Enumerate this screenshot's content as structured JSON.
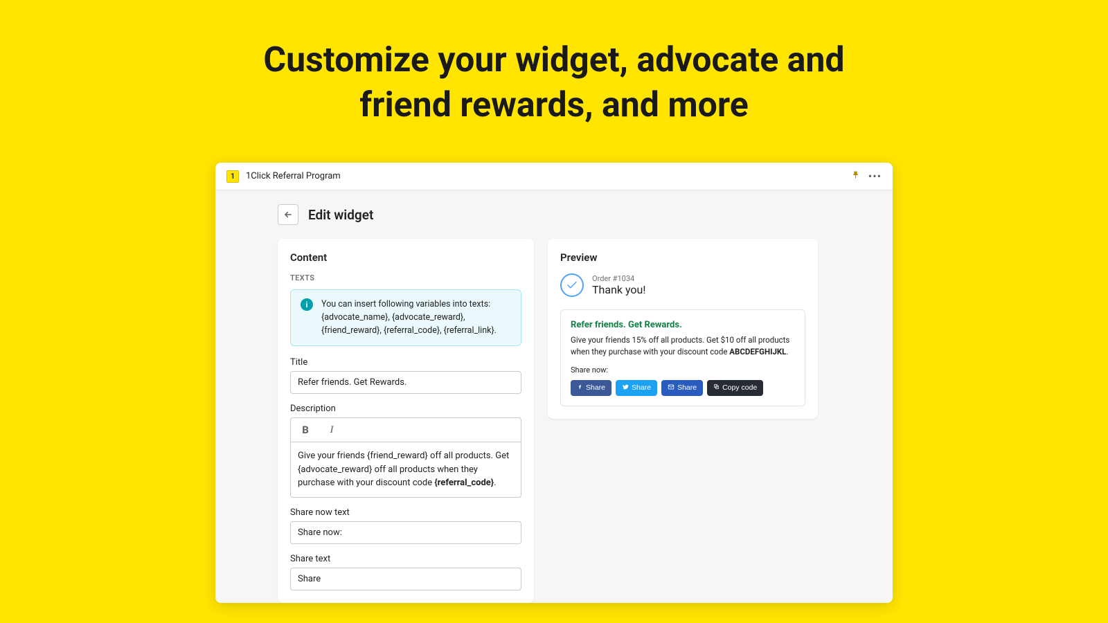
{
  "hero": {
    "headline": "Customize your widget, advocate and friend rewards, and more"
  },
  "app": {
    "badge": "1",
    "title": "1Click Referral Program"
  },
  "page": {
    "title": "Edit widget"
  },
  "content": {
    "heading": "Content",
    "texts_label": "TEXTS",
    "info": "You can insert following variables into texts: {advocate_name}, {advocate_reward}, {friend_reward}, {referral_code}, {referral_link}.",
    "fields": {
      "title_label": "Title",
      "title_value": "Refer friends. Get Rewards.",
      "description_label": "Description",
      "description_plain": "Give your friends {friend_reward} off all products. Get {advocate_reward} off all products when they purchase with your discount code ",
      "description_code": "{referral_code}",
      "description_suffix": ".",
      "share_now_label": "Share now text",
      "share_now_value": "Share now:",
      "share_text_label": "Share text",
      "share_text_value": "Share"
    }
  },
  "preview": {
    "heading": "Preview",
    "order_number": "Order #1034",
    "thank_you": "Thank you!",
    "widget_title": "Refer friends. Get Rewards.",
    "widget_desc_prefix": "Give your friends 15% off all products. Get $10 off all products when they purchase with your discount code ",
    "widget_desc_code": "ABCDEFGHIJKL",
    "widget_desc_suffix": ".",
    "share_now": "Share now:",
    "buttons": {
      "fb": "Share",
      "tw": "Share",
      "em": "Share",
      "copy": "Copy code"
    }
  }
}
